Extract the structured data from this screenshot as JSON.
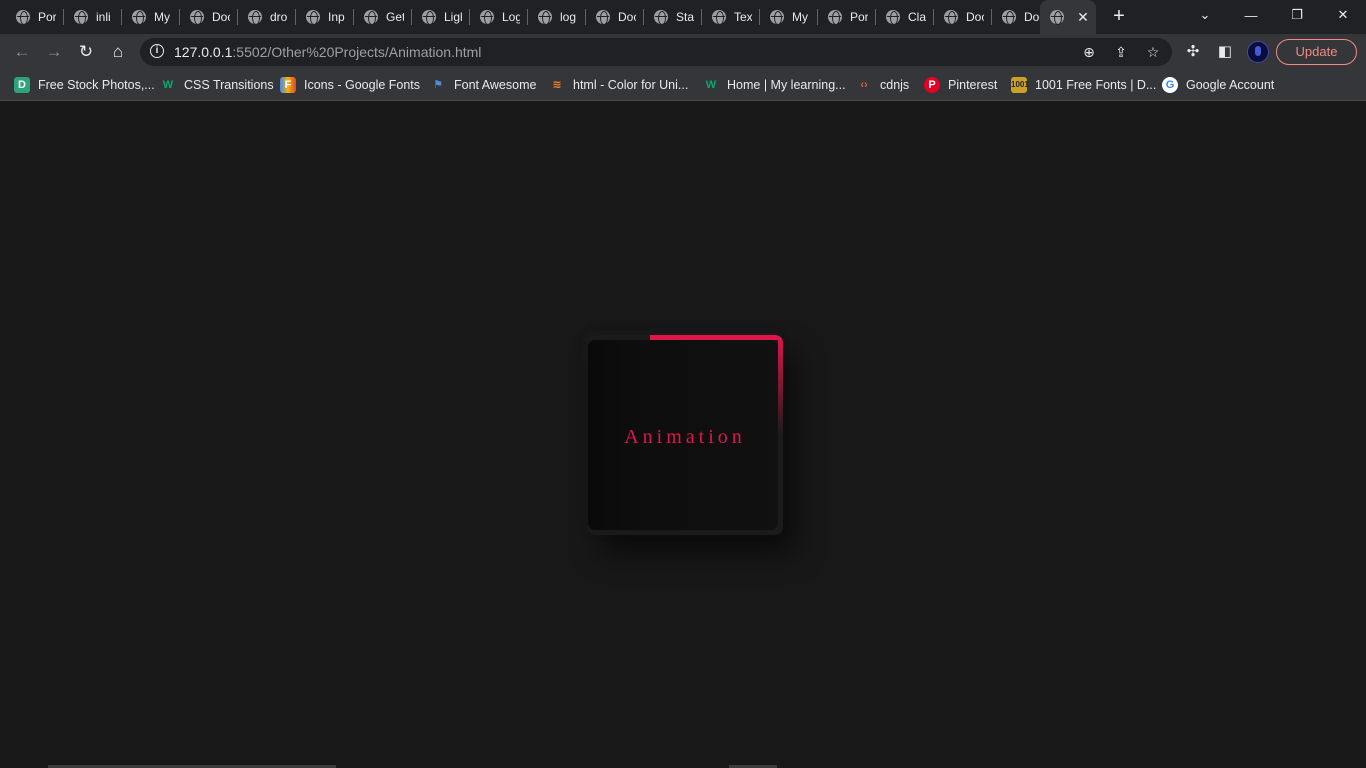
{
  "browser": {
    "tabs": [
      {
        "label": "Por"
      },
      {
        "label": "inli"
      },
      {
        "label": "My"
      },
      {
        "label": "Doc"
      },
      {
        "label": "dro"
      },
      {
        "label": "Inp"
      },
      {
        "label": "Get"
      },
      {
        "label": "Ligl"
      },
      {
        "label": "Log"
      },
      {
        "label": "log"
      },
      {
        "label": "Doc"
      },
      {
        "label": "Sta"
      },
      {
        "label": "Tex"
      },
      {
        "label": "My"
      },
      {
        "label": "Por"
      },
      {
        "label": "Cla"
      },
      {
        "label": "Doc"
      },
      {
        "label": "Doc"
      },
      {
        "label": ""
      }
    ],
    "new_tab_icon": "+",
    "close_tab_icon": "✕",
    "window_controls": {
      "dropdown": "⌄",
      "minimize": "—",
      "restore": "❐",
      "close": "✕"
    },
    "address_bar": {
      "host": "127.0.0.1",
      "path": ":5502/Other%20Projects/Animation.html"
    },
    "update_label": "Update",
    "bookmarks": [
      {
        "label": "Free Stock Photos,...",
        "icon": "photo-icon",
        "color": "#2ea37a"
      },
      {
        "label": "CSS Transitions",
        "icon": "w3-icon",
        "color": "#04aa6d"
      },
      {
        "label": "Icons - Google Fonts",
        "icon": "google-fonts-icon",
        "color": "#f4b400"
      },
      {
        "label": "Font Awesome",
        "icon": "flag-icon",
        "color": "#528dd7"
      },
      {
        "label": "html - Color for Uni...",
        "icon": "stackoverflow-icon",
        "color": "#f48024"
      },
      {
        "label": "Home | My learning...",
        "icon": "w3-icon",
        "color": "#04aa6d"
      },
      {
        "label": "cdnjs",
        "icon": "code-icon",
        "color": "#d9643a"
      },
      {
        "label": "Pinterest",
        "icon": "pinterest-icon",
        "color": "#e60023"
      },
      {
        "label": "1001 Free Fonts | D...",
        "icon": "fonts-icon",
        "color": "#c9a227"
      },
      {
        "label": "Google Account",
        "icon": "google-icon",
        "color": "#4285f4"
      }
    ]
  },
  "page": {
    "card_text": "Animation",
    "accent_color": "#e0164a",
    "background_color": "#181818"
  }
}
